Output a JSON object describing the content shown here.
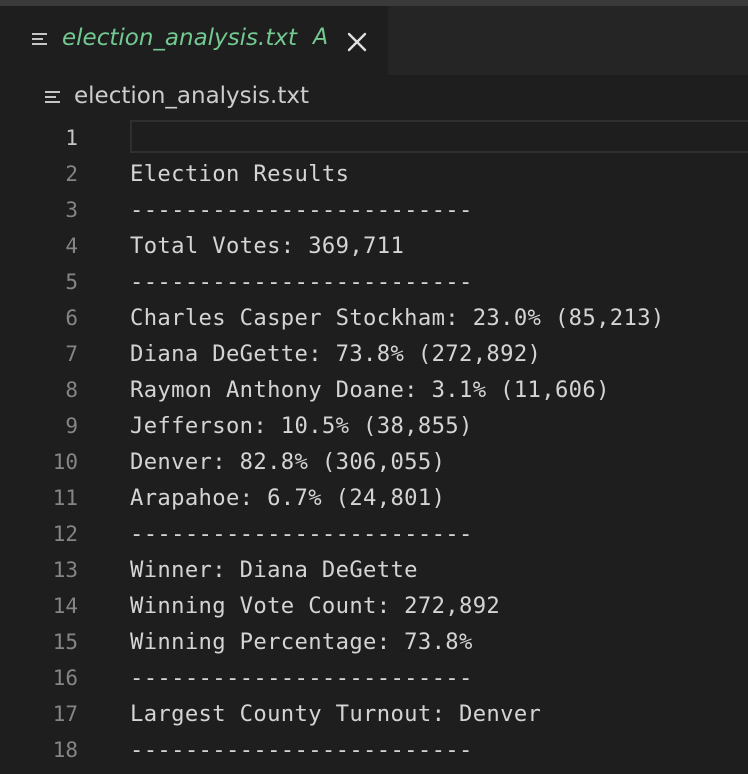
{
  "tab": {
    "filename": "election_analysis.txt",
    "badge": "A",
    "icon": "lines-icon",
    "close_icon": "close-icon"
  },
  "breadcrumb": {
    "filename": "election_analysis.txt",
    "icon": "lines-icon"
  },
  "colors": {
    "background": "#1e1e1e",
    "tab_bar": "#252526",
    "modified_green": "#73c991",
    "text": "#d4d4d4",
    "line_number": "#858585"
  },
  "editor": {
    "active_line": 1,
    "lines": [
      {
        "number": "1",
        "text": ""
      },
      {
        "number": "2",
        "text": "Election Results"
      },
      {
        "number": "3",
        "text": "-------------------------"
      },
      {
        "number": "4",
        "text": "Total Votes: 369,711"
      },
      {
        "number": "5",
        "text": "-------------------------"
      },
      {
        "number": "6",
        "text": "Charles Casper Stockham: 23.0% (85,213)"
      },
      {
        "number": "7",
        "text": "Diana DeGette: 73.8% (272,892)"
      },
      {
        "number": "8",
        "text": "Raymon Anthony Doane: 3.1% (11,606)"
      },
      {
        "number": "9",
        "text": "Jefferson: 10.5% (38,855)"
      },
      {
        "number": "10",
        "text": "Denver: 82.8% (306,055)"
      },
      {
        "number": "11",
        "text": "Arapahoe: 6.7% (24,801)"
      },
      {
        "number": "12",
        "text": "-------------------------"
      },
      {
        "number": "13",
        "text": "Winner: Diana DeGette"
      },
      {
        "number": "14",
        "text": "Winning Vote Count: 272,892"
      },
      {
        "number": "15",
        "text": "Winning Percentage: 73.8%"
      },
      {
        "number": "16",
        "text": "-------------------------"
      },
      {
        "number": "17",
        "text": "Largest County Turnout: Denver"
      },
      {
        "number": "18",
        "text": "-------------------------"
      }
    ]
  }
}
